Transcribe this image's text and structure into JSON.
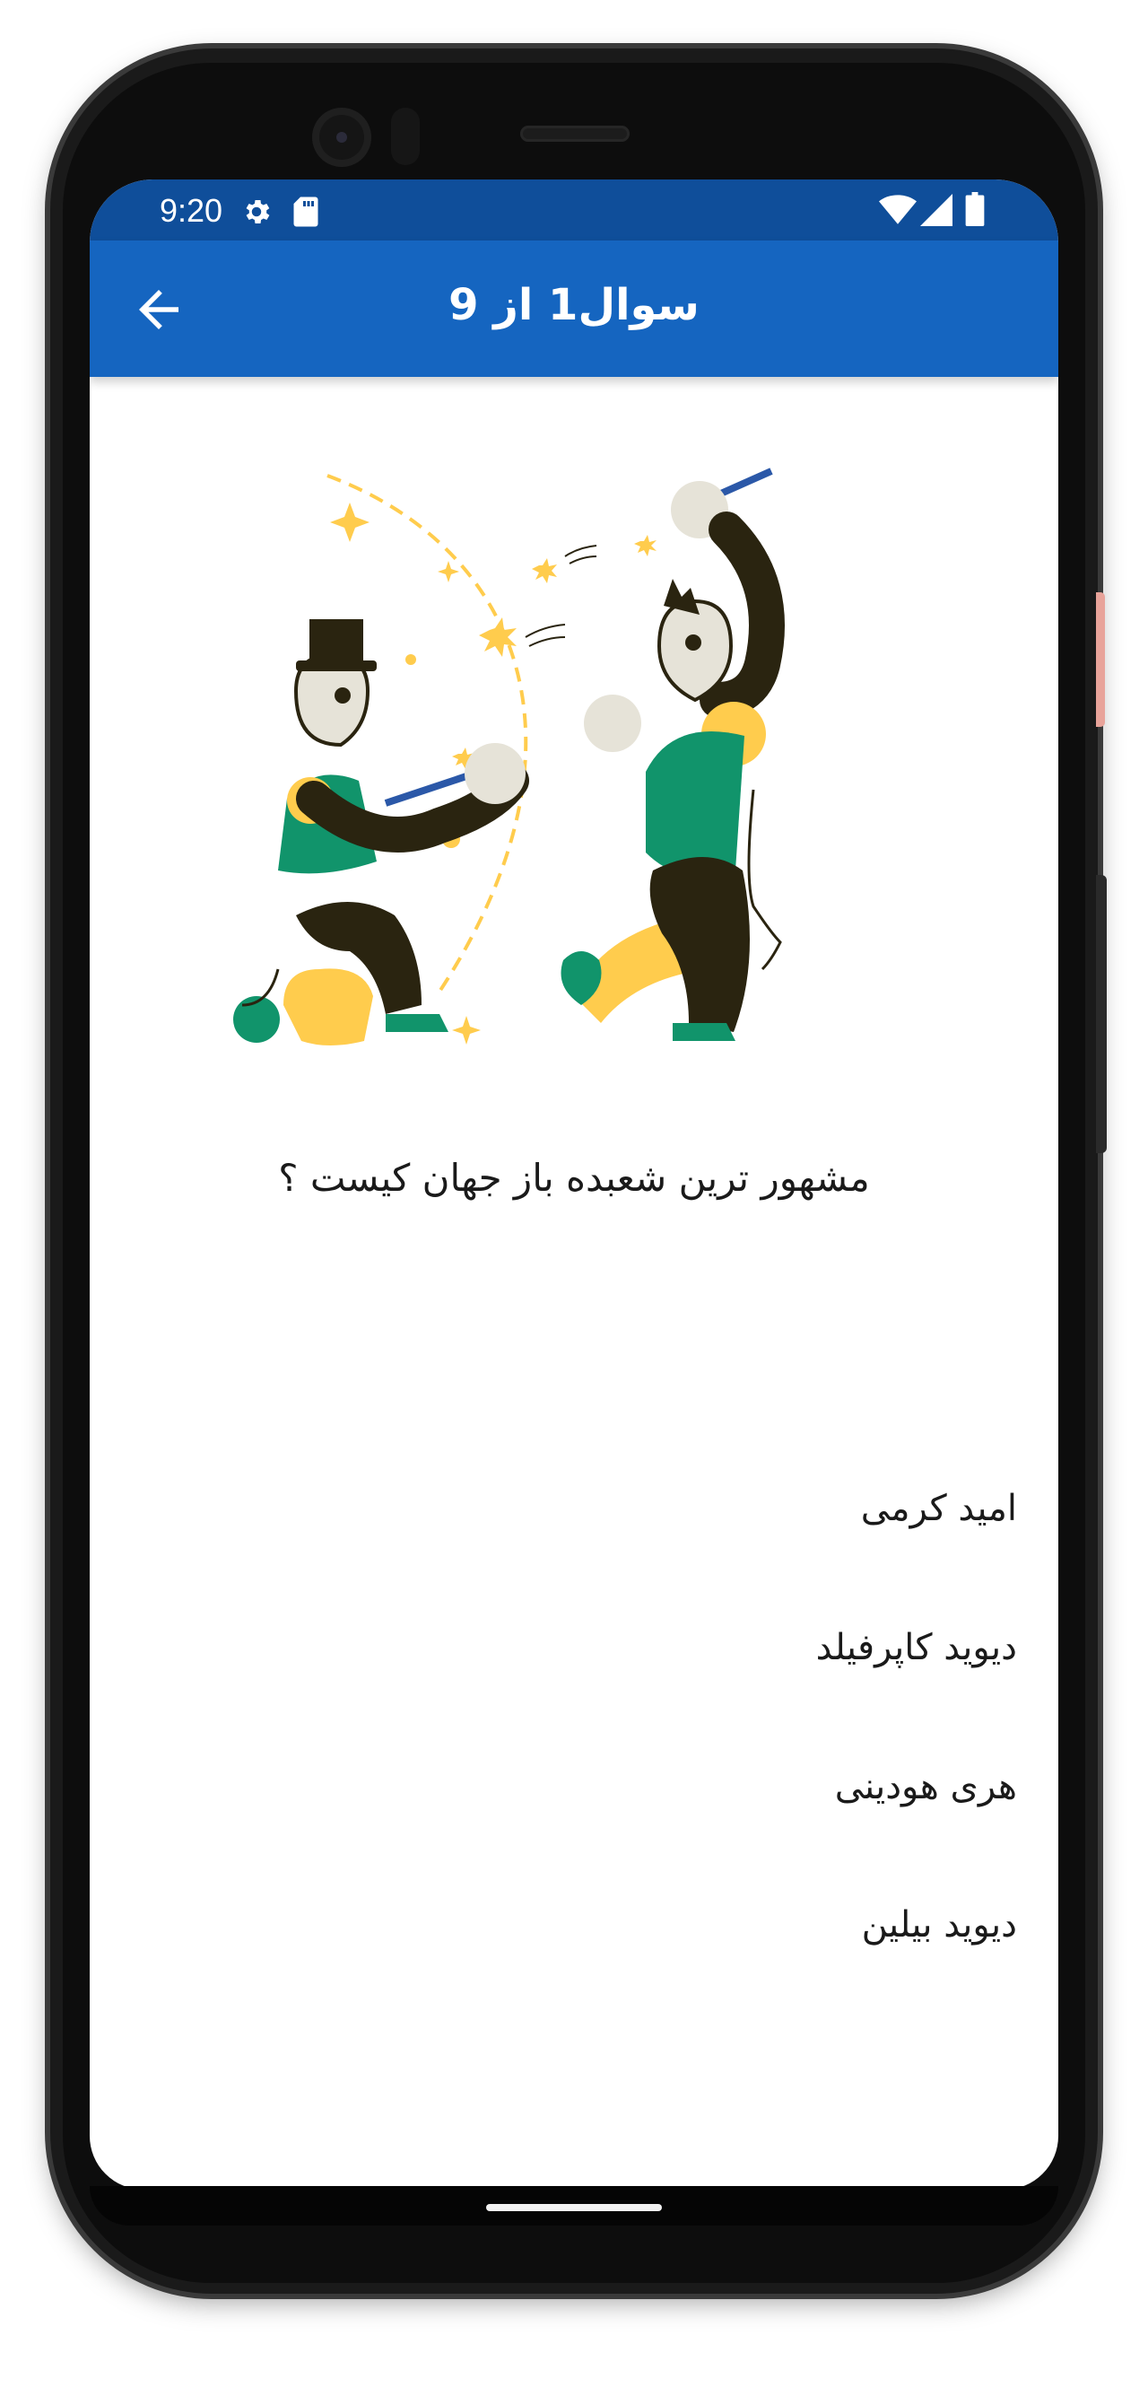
{
  "status_bar": {
    "time": "9:20",
    "icons": [
      "gear-icon",
      "sd-card-icon",
      "wifi-icon",
      "signal-icon",
      "battery-icon"
    ]
  },
  "app_bar": {
    "title": "سوال1 از 9",
    "back_icon": "arrow-left-icon",
    "color": "#1565c0",
    "status_color": "#0f4e9a"
  },
  "question": {
    "text": "مشهور ترین شعبده باز جهان کیست ؟",
    "illustration": "magicians-illustration"
  },
  "options": [
    {
      "label": "امید کرمی"
    },
    {
      "label": "دیوید کاپرفیلد"
    },
    {
      "label": "هری هودینی"
    },
    {
      "label": "دیوید بیلین"
    }
  ],
  "colors": {
    "green": "#11946b",
    "yellow": "#ffcc4d",
    "dark": "#2a2410",
    "cream": "#e6e3d8",
    "wand": "#2b58a8"
  }
}
